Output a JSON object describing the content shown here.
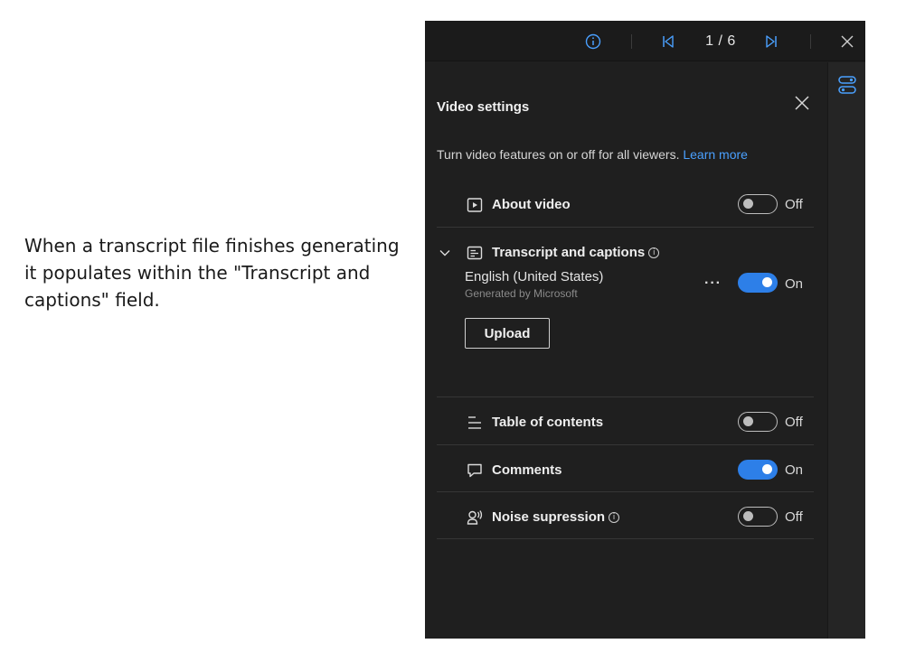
{
  "caption": "When a transcript file finishes generating it populates within the \"Transcript and captions\" field.",
  "topbar": {
    "counter": "1 / 6",
    "accent": "#4aa0ff"
  },
  "settings": {
    "title": "Video settings",
    "description": "Turn video features on or off for all viewers.",
    "learn_more": "Learn more",
    "rows": {
      "about_video": {
        "label": "About video",
        "state": "Off",
        "enabled": false
      },
      "transcript": {
        "label": "Transcript and captions"
      },
      "table_of_contents": {
        "label": "Table of contents",
        "state": "Off",
        "enabled": false
      },
      "comments": {
        "label": "Comments",
        "state": "On",
        "enabled": true
      },
      "noise": {
        "label": "Noise supression",
        "state": "Off",
        "enabled": false
      }
    },
    "transcript_item": {
      "language": "English (United States)",
      "source": "Generated by Microsoft",
      "more": "···",
      "state": "On",
      "enabled": true
    },
    "upload_label": "Upload"
  },
  "colors": {
    "panel_bg": "#1f1f1f",
    "toggle_on": "#2d7fe8",
    "link": "#4aa0ff"
  }
}
